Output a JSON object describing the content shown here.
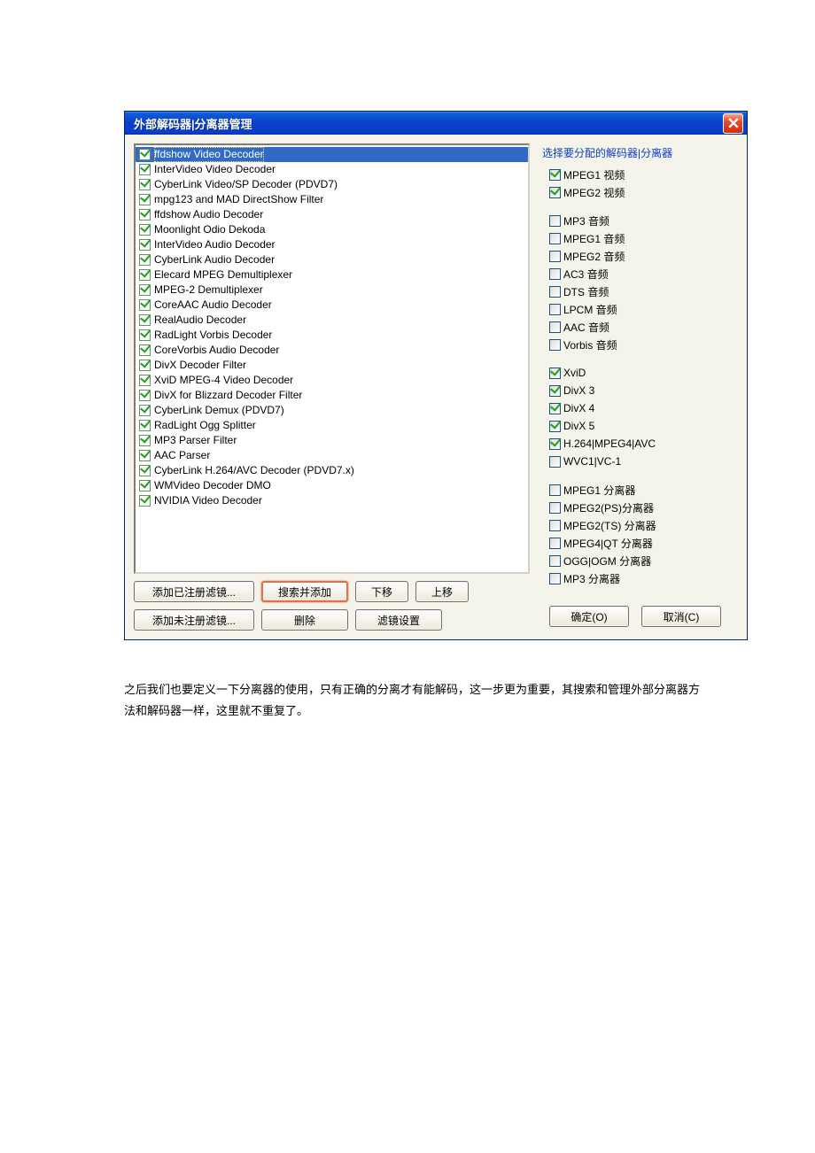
{
  "dialog": {
    "title": "外部解码器|分离器管理"
  },
  "decoders": [
    {
      "label": "ffdshow Video Decoder",
      "checked": true,
      "selected": true
    },
    {
      "label": "InterVideo Video Decoder",
      "checked": true
    },
    {
      "label": "CyberLink Video/SP Decoder (PDVD7)",
      "checked": true
    },
    {
      "label": "mpg123 and MAD DirectShow Filter",
      "checked": true
    },
    {
      "label": "ffdshow Audio Decoder",
      "checked": true
    },
    {
      "label": "Moonlight Odio Dekoda",
      "checked": true
    },
    {
      "label": "InterVideo Audio Decoder",
      "checked": true
    },
    {
      "label": "CyberLink Audio Decoder",
      "checked": true
    },
    {
      "label": "Elecard MPEG Demultiplexer",
      "checked": true
    },
    {
      "label": "MPEG-2 Demultiplexer",
      "checked": true
    },
    {
      "label": "CoreAAC Audio Decoder",
      "checked": true
    },
    {
      "label": "RealAudio Decoder",
      "checked": true
    },
    {
      "label": "RadLight Vorbis Decoder",
      "checked": true
    },
    {
      "label": "CoreVorbis Audio Decoder",
      "checked": true
    },
    {
      "label": "DivX Decoder Filter",
      "checked": true
    },
    {
      "label": "XviD MPEG-4 Video Decoder",
      "checked": true
    },
    {
      "label": "DivX for Blizzard Decoder Filter",
      "checked": true
    },
    {
      "label": "CyberLink Demux (PDVD7)",
      "checked": true
    },
    {
      "label": "RadLight Ogg Splitter",
      "checked": true
    },
    {
      "label": "MP3 Parser Filter",
      "checked": true
    },
    {
      "label": "AAC Parser",
      "checked": true
    },
    {
      "label": "CyberLink H.264/AVC Decoder (PDVD7.x)",
      "checked": true
    },
    {
      "label": "WMVideo Decoder DMO",
      "checked": true
    },
    {
      "label": "NVIDIA Video Decoder",
      "checked": true
    }
  ],
  "right": {
    "title": "选择要分配的解码器|分离器",
    "groups": [
      [
        {
          "label": "MPEG1 视频",
          "checked": true
        },
        {
          "label": "MPEG2 视频",
          "checked": true
        }
      ],
      [
        {
          "label": "MP3 音频",
          "checked": false
        },
        {
          "label": "MPEG1 音频",
          "checked": false
        },
        {
          "label": "MPEG2 音频",
          "checked": false
        },
        {
          "label": "AC3 音频",
          "checked": false
        },
        {
          "label": "DTS 音频",
          "checked": false
        },
        {
          "label": "LPCM 音频",
          "checked": false
        },
        {
          "label": "AAC 音频",
          "checked": false
        },
        {
          "label": "Vorbis 音频",
          "checked": false
        }
      ],
      [
        {
          "label": "XviD",
          "checked": true
        },
        {
          "label": "DivX 3",
          "checked": true
        },
        {
          "label": "DivX 4",
          "checked": true
        },
        {
          "label": "DivX 5",
          "checked": true
        },
        {
          "label": "H.264|MPEG4|AVC",
          "checked": true
        },
        {
          "label": "WVC1|VC-1",
          "checked": false
        }
      ],
      [
        {
          "label": "MPEG1 分离器",
          "checked": false
        },
        {
          "label": "MPEG2(PS)分离器",
          "checked": false
        },
        {
          "label": "MPEG2(TS) 分离器",
          "checked": false
        },
        {
          "label": "MPEG4|QT 分离器",
          "checked": false
        },
        {
          "label": "OGG|OGM 分离器",
          "checked": false
        },
        {
          "label": "MP3 分离器",
          "checked": false
        }
      ]
    ]
  },
  "buttons": {
    "add_registered": "添加已注册滤镜...",
    "search_add": "搜索并添加",
    "move_down": "下移",
    "move_up": "上移",
    "add_unregistered": "添加未注册滤镜...",
    "delete": "删除",
    "filter_settings": "滤镜设置",
    "ok": "确定(O)",
    "cancel": "取消(C)"
  },
  "body_text": "之后我们也要定义一下分离器的使用，只有正确的分离才有能解码，这一步更为重要，其搜索和管理外部分离器方法和解码器一样，这里就不重复了。"
}
